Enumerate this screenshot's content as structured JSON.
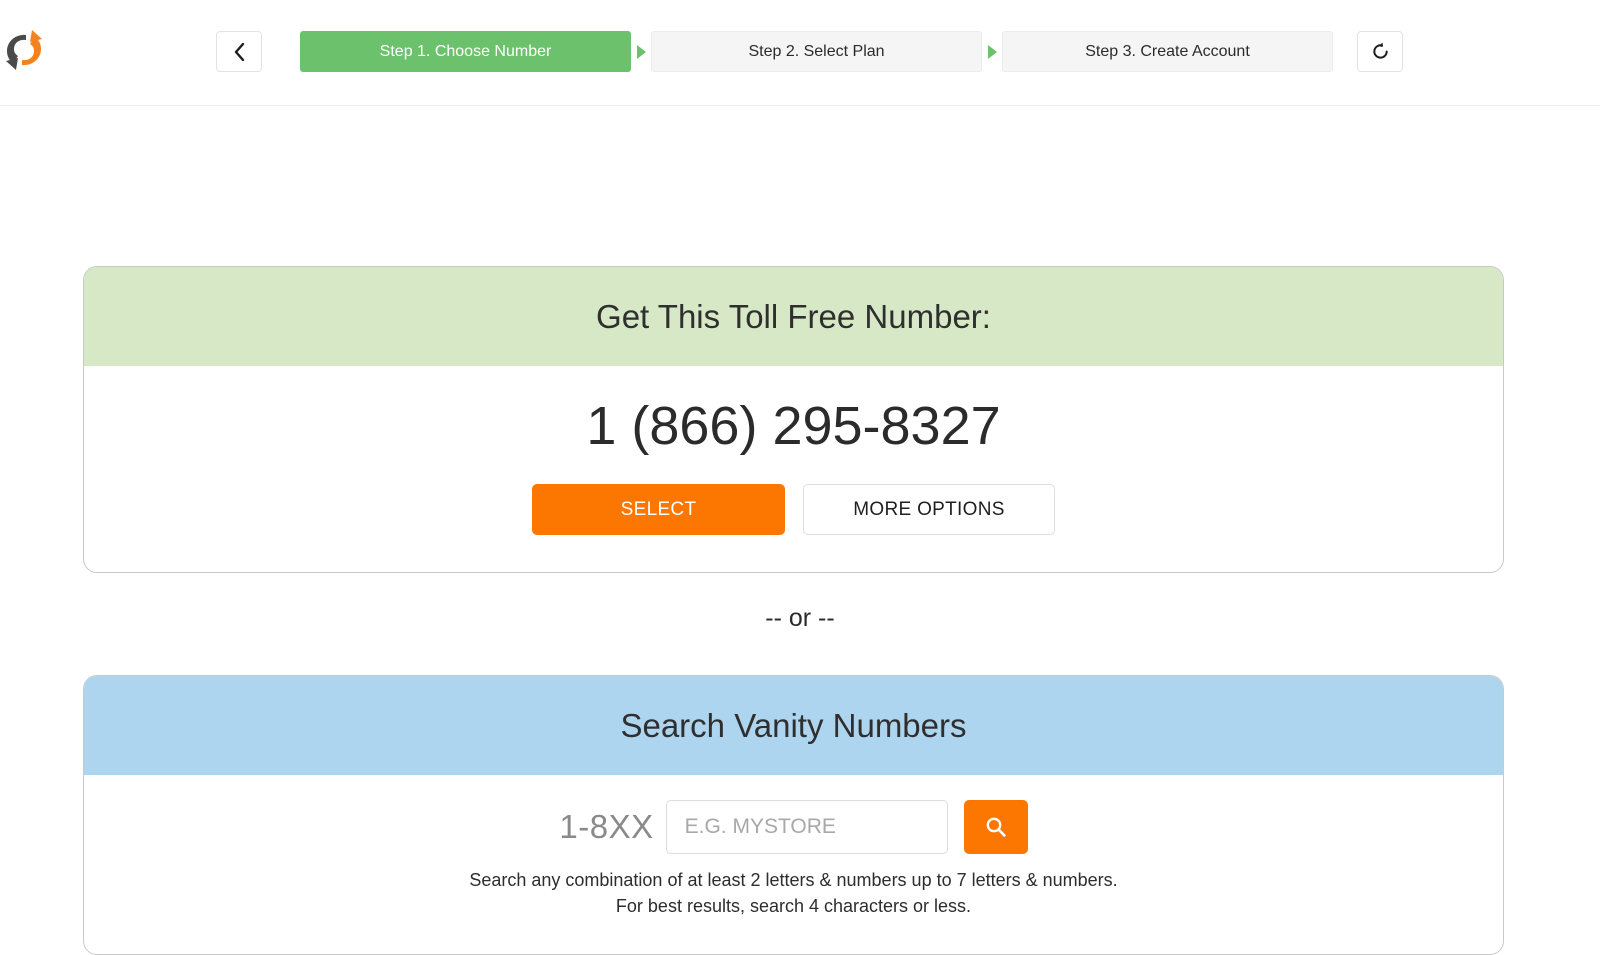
{
  "colors": {
    "brand_green": "#6cc16c",
    "header_green": "#d6e8c6",
    "header_blue": "#aed5ef",
    "accent_orange": "#fb7702",
    "step_inactive_bg": "#f5f5f5",
    "card_border": "#c9c9c9"
  },
  "topbar": {
    "logo_icon": "refresh-circular-arrows-logo",
    "back_button": {
      "icon": "chevron-left-icon",
      "glyph": "‹"
    },
    "reload_button": {
      "icon": "rotate-counterclockwise-icon"
    },
    "steps": [
      {
        "label": "Step 1. Choose Number",
        "active": true
      },
      {
        "label": "Step 2. Select Plan",
        "active": false
      },
      {
        "label": "Step 3. Create Account",
        "active": false
      }
    ]
  },
  "number_card": {
    "heading": "Get This Toll Free Number:",
    "phone_number": "1 (866) 295-8327",
    "select_label": "SELECT",
    "more_options_label": "MORE OPTIONS"
  },
  "divider": {
    "text": "-- or --"
  },
  "vanity_card": {
    "heading": "Search Vanity Numbers",
    "prefix": "1-8XX",
    "input_value": "",
    "input_placeholder": "E.G. MYSTORE",
    "search_icon": "magnifying-glass-icon",
    "hint_line_1": "Search any combination of at least 2 letters & numbers up to 7 letters & numbers.",
    "hint_line_2": "For best results, search 4 characters or less."
  }
}
